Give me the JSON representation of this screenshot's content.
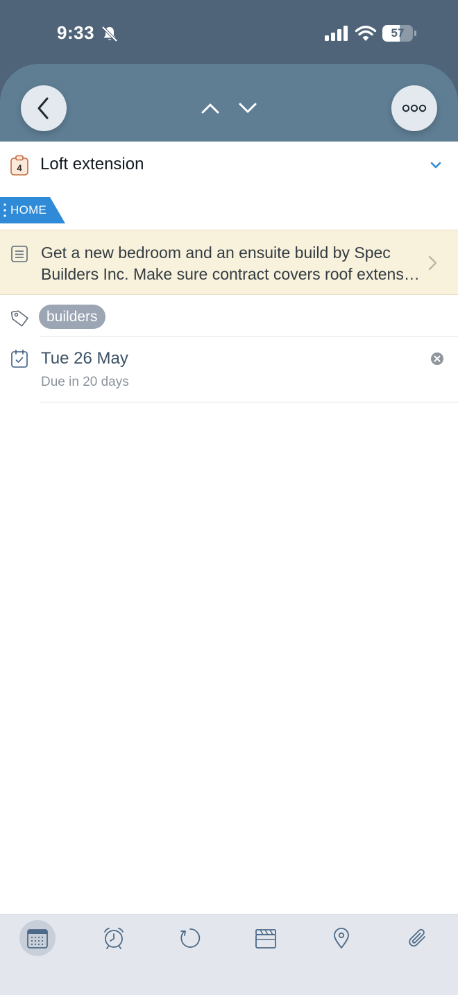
{
  "status_bar": {
    "time": "9:33",
    "battery_percent": "57",
    "battery_level": 0.57,
    "icons": [
      "bell-slash-icon",
      "cellular-signal-icon",
      "wifi-icon",
      "battery-icon"
    ]
  },
  "header": {
    "back_icon": "chevron-left-icon",
    "prev_icon": "chevron-up-icon",
    "next_icon": "chevron-down-icon",
    "more_icon": "ellipsis-icon"
  },
  "task": {
    "list_badge_count": "4",
    "title": "Loft extension",
    "list_tag": "HOME",
    "notes_line1": "Get a new bedroom and an ensuite build by Spec",
    "notes_line2": "Builders Inc. Make sure contract covers roof extension",
    "tags": [
      "builders"
    ],
    "due_date": "Tue 26 May",
    "due_relative": "Due in 20 days"
  },
  "toolbar": {
    "items": [
      {
        "name": "calendar",
        "icon": "calendar-icon",
        "active": true
      },
      {
        "name": "reminder",
        "icon": "alarm-clock-icon",
        "active": false
      },
      {
        "name": "repeat",
        "icon": "repeat-icon",
        "active": false
      },
      {
        "name": "checklist",
        "icon": "clapperboard-icon",
        "active": false
      },
      {
        "name": "location",
        "icon": "location-pin-icon",
        "active": false
      },
      {
        "name": "attachment",
        "icon": "paperclip-icon",
        "active": false
      }
    ]
  },
  "colors": {
    "status_bg": "#4f6478",
    "header_bg": "#5f7e94",
    "list_tag": "#2f8bd8",
    "notes_bg": "#f8f2dc",
    "tag_pill": "#9ba5b3",
    "toolbar_bg": "#e3e7ed",
    "accent": "#2f8bd8"
  }
}
